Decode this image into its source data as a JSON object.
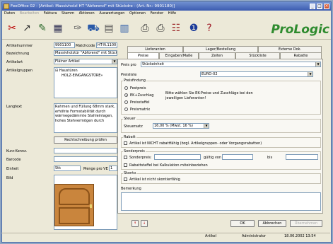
{
  "window": {
    "title": "FeeOffice 02 - [Artikel: Massivholzl HT \"Abforend\" mit Stückdre - (Art.-Nr.: 9901180)]",
    "controls": [
      "_",
      "□",
      "×"
    ]
  },
  "menu": [
    "Daten",
    "Bearbeiten",
    "Faktura",
    "Stamm",
    "Aktionen",
    "Auswertungen",
    "Optionen",
    "Fenster",
    "Hilfe"
  ],
  "toolbar": {
    "icons": [
      "scissors-icon",
      "pin-icon",
      "tools-icon",
      "grid-icon",
      "spray-icon",
      "car-icon",
      "calculator-icon",
      "calendar-icon",
      "printer-icon",
      "printer2-icon",
      "network-icon",
      "info-icon",
      "help-icon"
    ],
    "logo": "ProLogic"
  },
  "left": {
    "artikelnummer_label": "Artikelnummer",
    "artikelnummer": "9901100",
    "matchcode_label": "Matchcode",
    "matchcode": "HT-N.1100",
    "bezeichnung_label": "Bezeichnung",
    "bezeichnung": "Massivholztür \"Abforend\" mit Stückde",
    "artikelart_label": "Artikelart",
    "artikelart": "Fläiner Artikel",
    "artikelgruppen_label": "Artikelgruppen",
    "tree": [
      "Haustüren",
      "HOLZ-EINGANGSTÜRE»"
    ],
    "langtext_label": "Langtext",
    "langtext": "Rahmen und Füllung 68mm stark, erhöhte Formstabilität durch wärmegedämmte Stahleinlagen, hohes Stehvermögen durch",
    "rechtschreibung_button": "Rechtschreibung prüfen",
    "kurz_label": "Kurz-Kennz.",
    "barcode_label": "Barcode",
    "einheit_label": "Einheit",
    "einheit": "Stk",
    "menge_label": "Menge pro VE",
    "menge": "1",
    "bild_label": "Bild"
  },
  "tabs_top": [
    "Lieferanten",
    "Lager/Bestellung",
    "Externe Dok."
  ],
  "tabs_bottom": [
    "Preise",
    "Eingaben/Maße",
    "Zeiten",
    "Stückliste",
    "Rabatte"
  ],
  "preise": {
    "preis_pro_label": "Preis pro",
    "preis_pro": "Stückeinheit",
    "preisliste_label": "Preisliste",
    "preisliste": "EURO-02",
    "preisfindung_label": "Preisfindung",
    "options": [
      "Festpreis",
      "EK+Zuschlag",
      "Preisstaffel",
      "Preismatrix"
    ],
    "info": "Bitte wählen Sie EK-Preise und Zuschläge bei den jeweiligen Lieferanten!",
    "steuer_label": "Steuer",
    "steuersatz_label": "Steuersatz",
    "steuersatz": "16,00 % (Mwst. 16 %)",
    "rabatt_label": "Rabatt",
    "rabatt_check": "Artikel ist NICHT rabattfähig (bzgl. Artikelgruppen- oder Vorgangsrabatten)",
    "sonderpreis_label": "Sonderpreis",
    "sonderpreis_check": "Sonderpreis:",
    "gueltig_label": "gültig von",
    "bis_label": "bis",
    "rabattstaffel_check": "Rabattstaffel bei Kalkulation miteinbeziehen",
    "skonto_label": "Skonto",
    "skonto_check": "Artikel ist nicht skontierfähig",
    "bemerkung_label": "Bemerkung"
  },
  "buttons": {
    "ok": "OK",
    "abbrechen": "Abbrechen",
    "uebernehmen": "Übernehmen"
  },
  "nav": {
    "up": "↑",
    "down": "↓"
  },
  "status": {
    "left": "Artikel",
    "user": "Administrator",
    "datetime": "18.06.2002 13:54"
  }
}
